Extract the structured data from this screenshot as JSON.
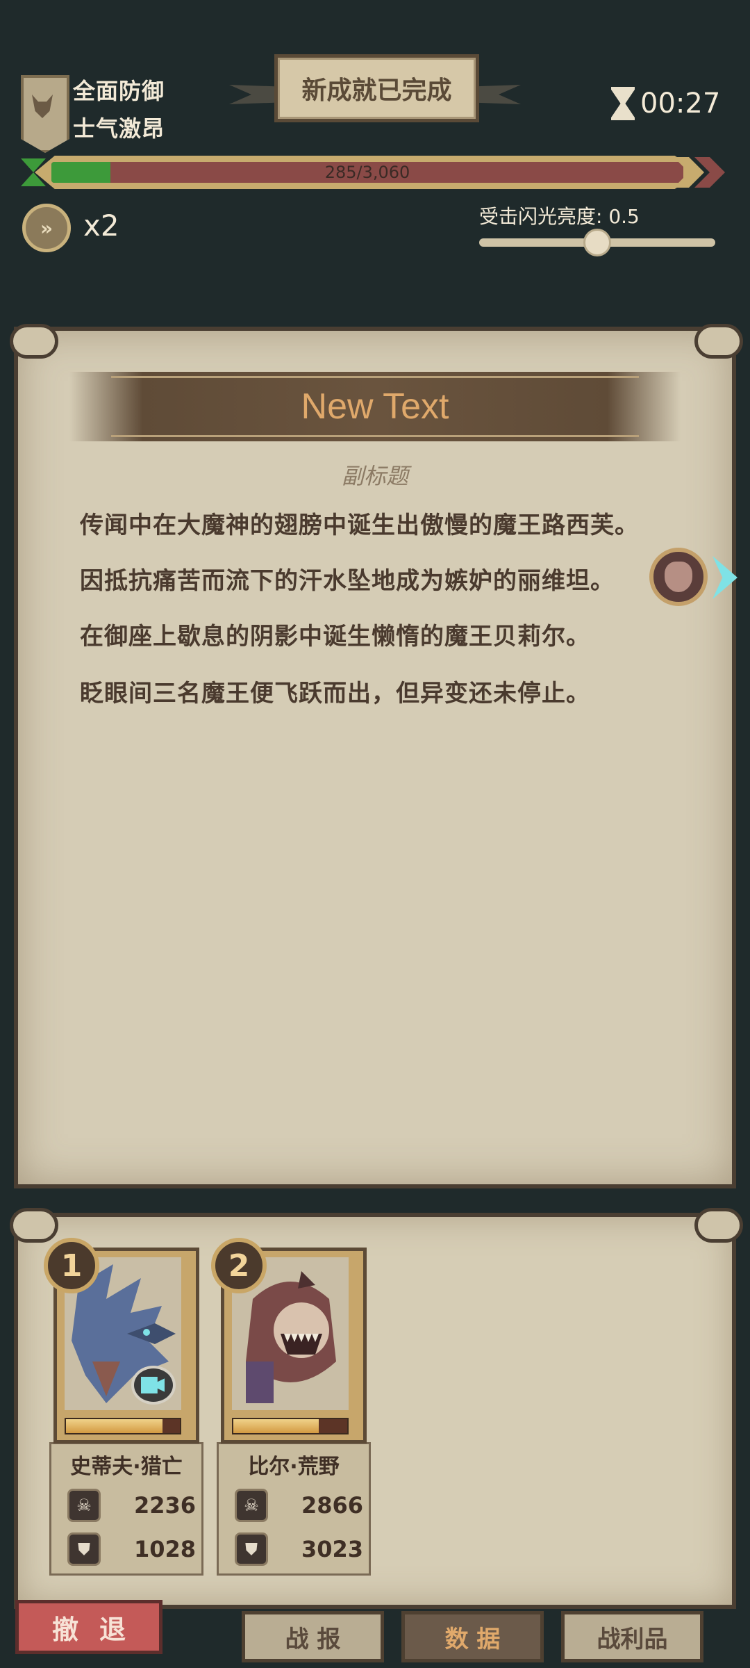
{
  "hud": {
    "status_line1": "全面防御",
    "status_line2": "士气激昂",
    "achievement_banner": "新成就已完成",
    "timer": "00:27",
    "progress": {
      "text": "285/3,060",
      "current": 285,
      "max": 3060
    },
    "speed_label": "x2",
    "flash_brightness": {
      "label": "受击闪光亮度: 0.5",
      "value": 0.5
    }
  },
  "story": {
    "title": "New Text",
    "subtitle": "副标题",
    "paragraphs": [
      "传闻中在大魔神的翅膀中诞生出傲慢的魔王路西芙。",
      "因抵抗痛苦而流下的汗水坠地成为嫉妒的丽维坦。",
      "在御座上歇息的阴影中诞生懒惰的魔王贝莉尔。",
      "眨眼间三名魔王便飞跃而出，但异变还未停止。"
    ]
  },
  "units": [
    {
      "rank": "1",
      "name": "史蒂夫·猎亡",
      "attack": "2236",
      "defense": "1028",
      "hp_fraction": 0.85
    },
    {
      "rank": "2",
      "name": "比尔·荒野",
      "attack": "2866",
      "defense": "3023",
      "hp_fraction": 0.75
    }
  ],
  "buttons": {
    "retreat": "撤退",
    "tab_report": "战 报",
    "tab_data": "数 据",
    "tab_loot": "战利品"
  },
  "icons": {
    "skull": "☠",
    "shield": "⛊",
    "fast_forward": "»"
  },
  "colors": {
    "background": "#1f2a2b",
    "parchment": "#d5ccb5",
    "title_text": "#e0a96b",
    "progress_fill": "#3d9a3a",
    "progress_track": "#8a4a47",
    "retreat_button": "#c45a58"
  }
}
